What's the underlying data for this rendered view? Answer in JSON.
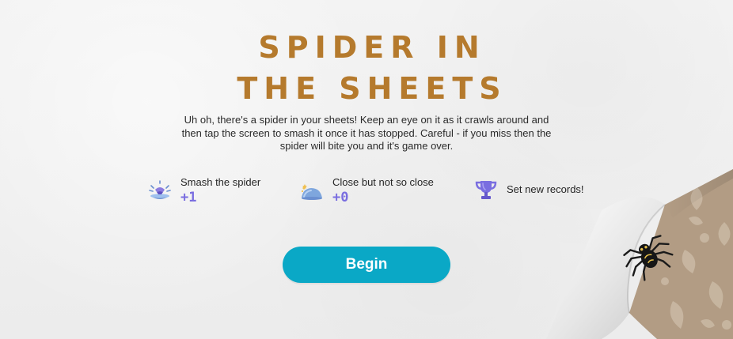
{
  "game": {
    "title_line1": "SPIDER IN",
    "title_line2": "THE SHEETS",
    "intro": "Uh oh, there's a spider in your sheets! Keep an eye on it as it crawls around and then tap the screen to smash it once it has stopped. Careful - if you miss then the spider will bite you and it's game over."
  },
  "features": [
    {
      "label": "Smash the spider",
      "points": "+1",
      "icon": "smash-icon"
    },
    {
      "label": "Close but not so close",
      "points": "+0",
      "icon": "close-miss-icon"
    },
    {
      "label": "Set new records!",
      "icon": "trophy-icon"
    }
  ],
  "actions": {
    "begin_label": "Begin"
  },
  "colors": {
    "title": "#b57a2d",
    "points": "#7a6ee0",
    "button": "#0aa8c6",
    "paper": "#efefef",
    "fabric": "#b29c84"
  }
}
